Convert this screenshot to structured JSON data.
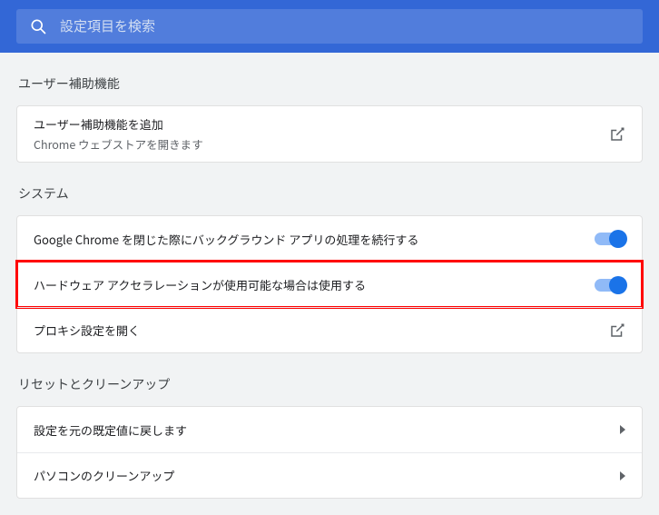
{
  "search": {
    "placeholder": "設定項目を検索"
  },
  "sections": {
    "accessibility": {
      "heading": "ユーザー補助機能",
      "addTitle": "ユーザー補助機能を追加",
      "addSubtitle": "Chrome ウェブストアを開きます"
    },
    "system": {
      "heading": "システム",
      "rows": {
        "background": "Google Chrome を閉じた際にバックグラウンド アプリの処理を続行する",
        "hardware": "ハードウェア アクセラレーションが使用可能な場合は使用する",
        "proxy": "プロキシ設定を開く"
      }
    },
    "reset": {
      "heading": "リセットとクリーンアップ",
      "rows": {
        "restore": "設定を元の既定値に戻します",
        "cleanup": "パソコンのクリーンアップ"
      }
    }
  }
}
